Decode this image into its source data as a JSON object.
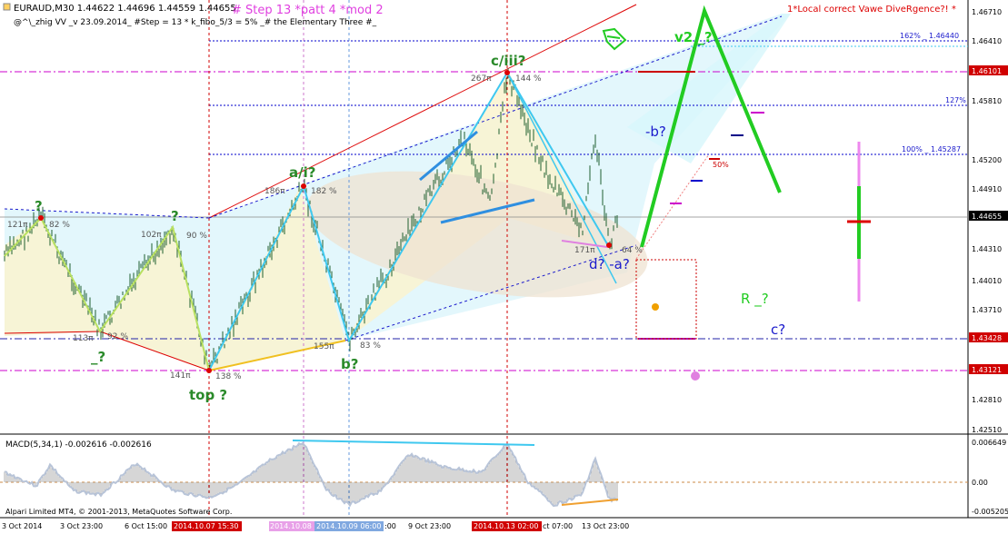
{
  "header": {
    "line1": "EURAUD,M30  1.44622 1.44696 1.44559 1.44655",
    "line2": "@^\\_zhig VV   _v 23.09.2014_ #Step = 13   * k_fibo_5/3 = 5%   _#   the Elementary Three  #_",
    "step_label": "# Step 13   *patt 4   *mod 2",
    "divergence": "1*Local correct Vawe DiveRgence?! *"
  },
  "price_axis": {
    "ticks": [
      "1.46710",
      "1.46410",
      "1.46101",
      "1.45810",
      "1.45200",
      "1.44910",
      "1.44655",
      "1.44310",
      "1.44010",
      "1.43710",
      "1.43428",
      "1.43121",
      "1.42810",
      "1.42510"
    ],
    "current": "1.44655",
    "highlight_red": [
      "1.46101",
      "1.43428",
      "1.43121"
    ]
  },
  "fibo_labels": {
    "f162": "162% _ 1.46440",
    "f127": "127%",
    "f100": "100% _ 1.45287",
    "f50": "50%"
  },
  "wave_labels": {
    "q1": "?",
    "q2": "?",
    "under": "_?",
    "top": "top ?",
    "ai": "a/i?",
    "b": "b?",
    "ciii": "c/iii?",
    "da": "d? -a?",
    "mb": "-b?",
    "v2": "v2 _?",
    "r": "R _?",
    "c": "c?"
  },
  "point_labels": {
    "p121": "121π",
    "p82": "82 %",
    "p113": "113π",
    "p92": "92 %",
    "p102": "102π",
    "p90": "90 %",
    "p141": "141π",
    "p138": "138 %",
    "p186": "186π",
    "p182": "182 %",
    "p155": "155π",
    "p83": "83 %",
    "p267": "267π",
    "p144": "144 %",
    "p171": "171π",
    "p64": "64 %"
  },
  "macd": {
    "label": "MACD(5,34,1) -0.002616 -0.002616",
    "ticks": [
      "0.006649",
      "0.00",
      "-0.005205"
    ]
  },
  "time_axis": {
    "labels": [
      "3 Oct 2014",
      "3 Oct 23:00",
      "6 Oct 15:00",
      "9 Oct 23:00",
      "ct 07:00",
      "13 Oct 23:00"
    ],
    "red_labels": [
      "2014.10.07 15:30",
      "2014.10.13 02:00"
    ],
    "pink_label": "2014.10.08",
    "blue_label": "2014.10.09 06:00",
    "tail1": ":00"
  },
  "copyright": "Alpari Limited MT4, © 2001-2013, MetaQuotes Software Corp.",
  "colors": {
    "fib_magenta": "#cc00cc",
    "fib_blue": "#0000cc",
    "wave_cyan": "#3fc8ef",
    "wave_green": "#22cc22",
    "trend_red": "#dd0000",
    "price_box_red": "#d00000"
  }
}
